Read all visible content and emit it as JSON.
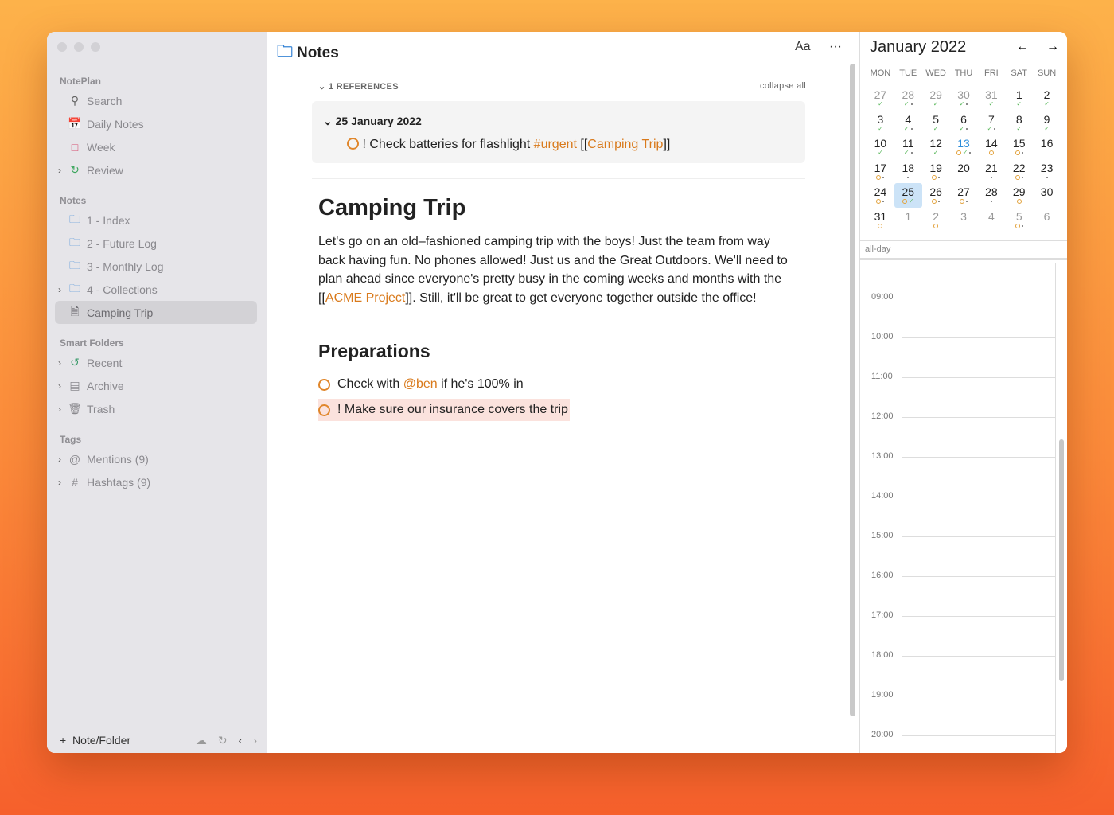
{
  "sidebar": {
    "section_noteplan": "NotePlan",
    "search": "Search",
    "daily_notes": "Daily Notes",
    "week": "Week",
    "review": "Review",
    "section_notes": "Notes",
    "folders": [
      "1 - Index",
      "2 - Future Log",
      "3 - Monthly Log",
      "4 - Collections"
    ],
    "selected_note": "Camping Trip",
    "section_smart": "Smart Folders",
    "recent": "Recent",
    "archive": "Archive",
    "trash": "Trash",
    "section_tags": "Tags",
    "mentions": "Mentions (9)",
    "hashtags": "Hashtags (9)",
    "add_label": "Note/Folder"
  },
  "toolbar": {
    "title": "Notes",
    "font_btn": "Aa",
    "more_btn": "···"
  },
  "references": {
    "header": "1 REFERENCES",
    "collapse": "collapse all",
    "date": "25 January 2022",
    "task_prefix": "! Check batteries for flashlight ",
    "tag": "#urgent",
    "lb": " [[",
    "link": "Camping Trip",
    "rb": "]]"
  },
  "note": {
    "title": "Camping Trip",
    "para_a": "Let's go on an old–fashioned camping trip with the boys! Just the team from way back having fun. No phones allowed! Just us and the Great Outdoors. We'll need to plan ahead since everyone's pretty busy in the coming weeks and months with the [[",
    "para_link": "ACME Project",
    "para_b": "]]. Still, it'll be great to get everyone together outside the office!",
    "h2": "Preparations",
    "task1_a": "Check with ",
    "task1_mention": "@ben",
    "task1_b": " if he's 100% in",
    "task2": "! Make sure our insurance covers the trip"
  },
  "calendar": {
    "month": "January 2022",
    "weekdays": [
      "MON",
      "TUE",
      "WED",
      "THU",
      "FRI",
      "SAT",
      "SUN"
    ],
    "days": [
      {
        "d": "27",
        "m": 1,
        "k": "c"
      },
      {
        "d": "28",
        "m": 1,
        "k": "cd"
      },
      {
        "d": "29",
        "m": 1,
        "k": "c"
      },
      {
        "d": "30",
        "m": 1,
        "k": "cd"
      },
      {
        "d": "31",
        "m": 1,
        "k": "c"
      },
      {
        "d": "1",
        "k": "c"
      },
      {
        "d": "2",
        "k": "c"
      },
      {
        "d": "3",
        "k": "c"
      },
      {
        "d": "4",
        "k": "cd"
      },
      {
        "d": "5",
        "k": "c"
      },
      {
        "d": "6",
        "k": "cd"
      },
      {
        "d": "7",
        "k": "cd"
      },
      {
        "d": "8",
        "k": "c"
      },
      {
        "d": "9",
        "k": "c"
      },
      {
        "d": "10",
        "k": "c"
      },
      {
        "d": "11",
        "k": "cd"
      },
      {
        "d": "12",
        "k": "c"
      },
      {
        "d": "13",
        "t": 1,
        "k": "ocd"
      },
      {
        "d": "14",
        "k": "o"
      },
      {
        "d": "15",
        "k": "od"
      },
      {
        "d": "16",
        "k": ""
      },
      {
        "d": "17",
        "k": "od"
      },
      {
        "d": "18",
        "k": "d"
      },
      {
        "d": "19",
        "k": "od"
      },
      {
        "d": "20",
        "k": ""
      },
      {
        "d": "21",
        "k": "d"
      },
      {
        "d": "22",
        "k": "od"
      },
      {
        "d": "23",
        "k": "d"
      },
      {
        "d": "24",
        "k": "od"
      },
      {
        "d": "25",
        "s": 1,
        "k": "oc"
      },
      {
        "d": "26",
        "k": "od"
      },
      {
        "d": "27",
        "k": "od"
      },
      {
        "d": "28",
        "k": "d"
      },
      {
        "d": "29",
        "k": "o"
      },
      {
        "d": "30",
        "k": ""
      },
      {
        "d": "31",
        "k": "o"
      },
      {
        "d": "1",
        "m": 1,
        "k": ""
      },
      {
        "d": "2",
        "m": 1,
        "k": "o"
      },
      {
        "d": "3",
        "m": 1,
        "k": ""
      },
      {
        "d": "4",
        "m": 1,
        "k": ""
      },
      {
        "d": "5",
        "m": 1,
        "k": "od"
      },
      {
        "d": "6",
        "m": 1,
        "k": ""
      }
    ],
    "allday": "all-day",
    "hours": [
      "09:00",
      "10:00",
      "11:00",
      "12:00",
      "13:00",
      "14:00",
      "15:00",
      "16:00",
      "17:00",
      "18:00",
      "19:00",
      "20:00"
    ]
  }
}
